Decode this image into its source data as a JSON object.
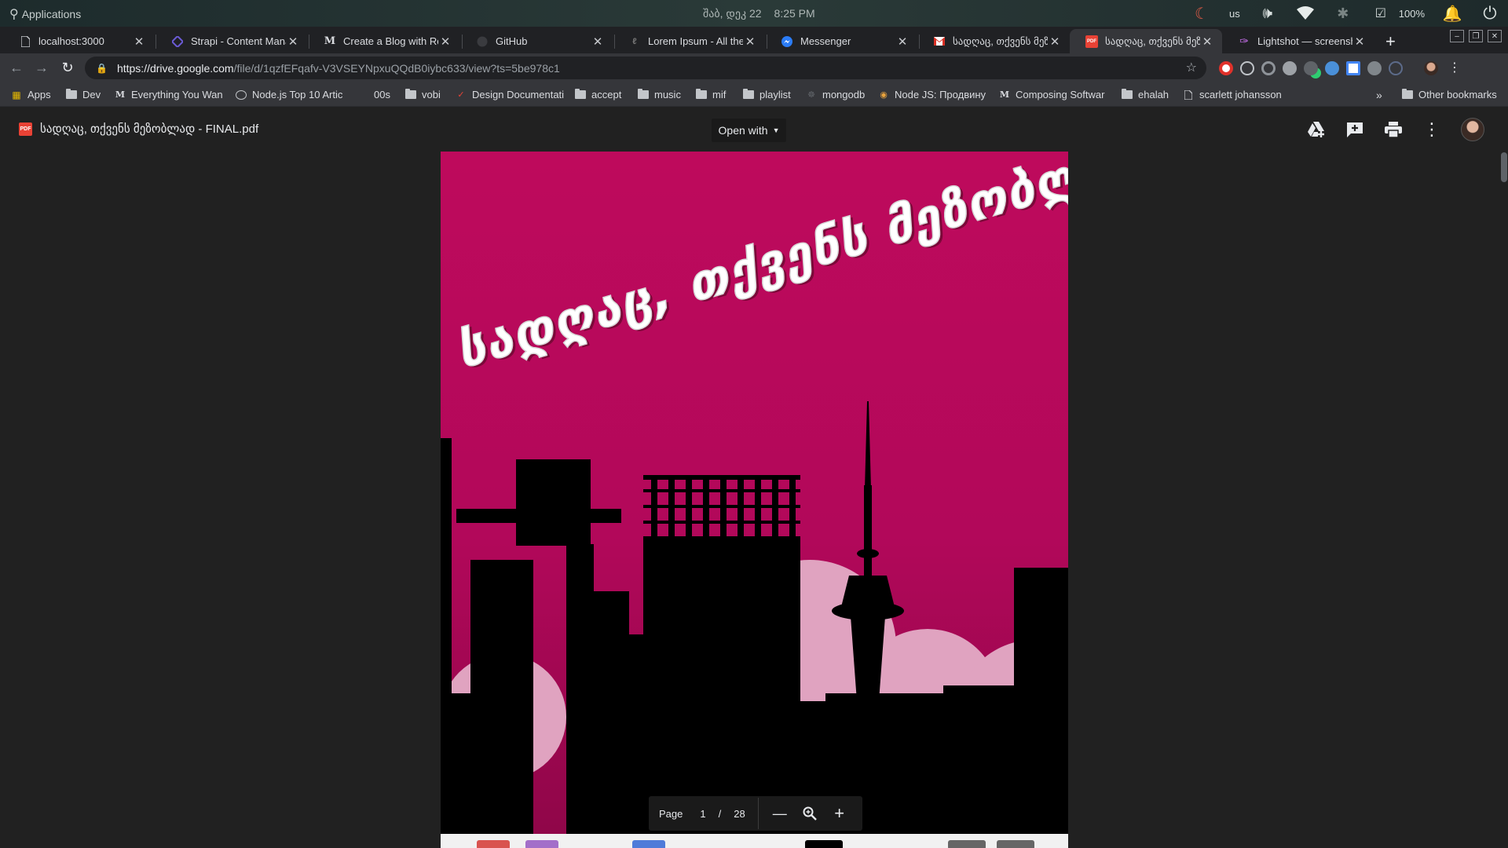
{
  "os": {
    "launcher_label": "Applications",
    "date": "შაბ, დეკ 22",
    "time": "8:25 PM",
    "keyboard_layout": "us",
    "battery": "100%"
  },
  "tabs": [
    {
      "title": "localhost:3000",
      "icon": "page-icon",
      "active": false
    },
    {
      "title": "Strapi - Content Manag",
      "icon": "strapi-icon",
      "active": false
    },
    {
      "title": "Create a Blog with Rea",
      "icon": "medium-icon",
      "active": false
    },
    {
      "title": "GitHub",
      "icon": "github-icon",
      "active": false
    },
    {
      "title": "Lorem Ipsum - All the f",
      "icon": "lorem-icon",
      "active": false
    },
    {
      "title": "Messenger",
      "icon": "messenger-icon",
      "active": false
    },
    {
      "title": "სადღაც, თქვენს მეზ",
      "icon": "gmail-icon",
      "active": false
    },
    {
      "title": "სადღაც, თქვენს მეზ",
      "icon": "pdf-icon",
      "active": true
    },
    {
      "title": "Lightshot — screensho",
      "icon": "lightshot-icon",
      "active": false
    }
  ],
  "address_bar": {
    "url_host": "https://drive.google.com",
    "url_path": "/file/d/1qzfEFqafv-V3VSEYNpxuQQdB0iybc633/view?ts=5be978c1"
  },
  "bookmarks": [
    {
      "label": "Apps",
      "icon": "apps-grid-icon"
    },
    {
      "label": "Dev",
      "icon": "folder-icon"
    },
    {
      "label": "Everything You Wan",
      "icon": "medium-icon"
    },
    {
      "label": "Node.js Top 10 Artic",
      "icon": "page-icon"
    },
    {
      "label": "00s",
      "icon": "none"
    },
    {
      "label": "vobi",
      "icon": "folder-icon"
    },
    {
      "label": "Design Documentati",
      "icon": "design-icon"
    },
    {
      "label": "accept",
      "icon": "folder-icon"
    },
    {
      "label": "music",
      "icon": "folder-icon"
    },
    {
      "label": "mif",
      "icon": "folder-icon"
    },
    {
      "label": "playlist",
      "icon": "folder-icon"
    },
    {
      "label": "mongodb",
      "icon": "mongodb-icon"
    },
    {
      "label": "Node JS: Продвину",
      "icon": "node-icon"
    },
    {
      "label": "Composing Softwar",
      "icon": "medium-icon"
    },
    {
      "label": "ehalah",
      "icon": "folder-icon"
    },
    {
      "label": "scarlett johansson",
      "icon": "page-icon"
    }
  ],
  "bookmarks_other": "Other bookmarks",
  "viewer": {
    "file_name": "სადღაც, თქვენს მეზობლად - FINAL.pdf",
    "open_with_label": "Open with",
    "page_label": "Page",
    "current_page": "1",
    "page_separator": "/",
    "total_pages": "28"
  },
  "pdf_page": {
    "title_text": "სადღაც, თქვენს მეზობლად...",
    "background_color": "#b80c5a",
    "moon_color": "#e0a3c0",
    "skyline_color": "#000000"
  }
}
